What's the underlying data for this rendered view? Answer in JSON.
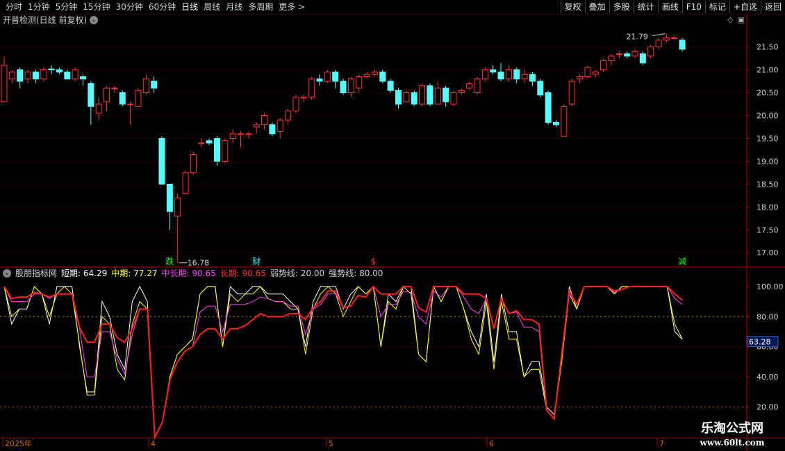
{
  "toolbar": {
    "periods": [
      "分时",
      "1分钟",
      "5分钟",
      "15分钟",
      "30分钟",
      "60分钟",
      "日线",
      "周线",
      "月线",
      "多周期",
      "更多 >"
    ],
    "active_period": "日线",
    "right_buttons": [
      "复权",
      "叠加",
      "多股",
      "统计",
      "画线",
      "F10",
      "标记",
      "+自选",
      "返回"
    ]
  },
  "main_panel": {
    "title": "开普检测(日线 前复权)",
    "icons": [
      "diamond-icon",
      "window-icon"
    ],
    "high_label": "21.79",
    "low_label": "16.78",
    "event_markers": [
      {
        "text": "跌",
        "color": "#00ff00"
      },
      {
        "text": "财",
        "color": "#00ffff"
      },
      {
        "text": "$",
        "color": "#ff3030"
      },
      {
        "text": "减",
        "color": "#00ff00"
      }
    ]
  },
  "indicator": {
    "name": "股朋指标网",
    "short_label": "短期:",
    "short_value": "64.29",
    "mid_label": "中期:",
    "mid_value": "77.27",
    "midlong_label": "中长期:",
    "midlong_value": "90.65",
    "long_label": "长期:",
    "long_value": "90.65",
    "weak_label": "弱势线:",
    "weak_value": "20.00",
    "strong_label": "强势线:",
    "strong_value": "80.00",
    "current_value": "63.28"
  },
  "x_axis": {
    "labels": [
      "2025年",
      "4",
      "5",
      "6",
      "7"
    ]
  },
  "watermark": {
    "line1": "乐淘公式网",
    "line2": "www.60lt.com"
  },
  "colors": {
    "up": "#ff3232",
    "down": "#54ffff",
    "short": "#ffffff",
    "mid": "#ffff00",
    "midlong": "#ff40ff",
    "long": "#ff2020",
    "grid": "#6b0000",
    "axis": "#b00000"
  },
  "chart_data": [
    {
      "type": "candlestick",
      "title": "开普检测(日线 前复权)",
      "y_ticks": [
        17.0,
        17.5,
        18.0,
        18.5,
        19.0,
        19.5,
        20.0,
        20.5,
        21.0,
        21.5
      ],
      "ylim": [
        16.7,
        21.95
      ],
      "candles": [
        {
          "o": 20.3,
          "c": 21.1,
          "h": 21.3,
          "l": 20.3
        },
        {
          "o": 20.8,
          "c": 20.95,
          "h": 21.0,
          "l": 20.7
        },
        {
          "o": 21.0,
          "c": 20.75,
          "h": 21.05,
          "l": 20.6
        },
        {
          "o": 20.8,
          "c": 20.95,
          "h": 21.0,
          "l": 20.7
        },
        {
          "o": 20.95,
          "c": 20.8,
          "h": 21.0,
          "l": 20.7
        },
        {
          "o": 20.8,
          "c": 21.0,
          "h": 21.05,
          "l": 20.75
        },
        {
          "o": 21.02,
          "c": 21.0,
          "h": 21.1,
          "l": 20.9
        },
        {
          "o": 21.0,
          "c": 20.95,
          "h": 21.05,
          "l": 20.9
        },
        {
          "o": 20.95,
          "c": 20.8,
          "h": 21.0,
          "l": 20.8
        },
        {
          "o": 20.8,
          "c": 21.0,
          "h": 21.05,
          "l": 20.75
        },
        {
          "o": 20.85,
          "c": 20.8,
          "h": 20.9,
          "l": 20.65
        },
        {
          "o": 20.7,
          "c": 20.2,
          "h": 20.75,
          "l": 19.8
        },
        {
          "o": 20.05,
          "c": 20.25,
          "h": 20.4,
          "l": 19.9
        },
        {
          "o": 20.3,
          "c": 20.6,
          "h": 20.65,
          "l": 20.1
        },
        {
          "o": 20.6,
          "c": 20.6,
          "h": 20.65,
          "l": 20.5
        },
        {
          "o": 20.5,
          "c": 20.25,
          "h": 20.55,
          "l": 20.2
        },
        {
          "o": 20.25,
          "c": 20.25,
          "h": 20.3,
          "l": 19.8
        },
        {
          "o": 20.2,
          "c": 20.55,
          "h": 20.6,
          "l": 20.2
        },
        {
          "o": 20.5,
          "c": 20.8,
          "h": 20.9,
          "l": 20.45
        },
        {
          "o": 20.75,
          "c": 20.6,
          "h": 20.85,
          "l": 20.5
        },
        {
          "o": 19.5,
          "c": 18.5,
          "h": 19.55,
          "l": 18.5
        },
        {
          "o": 18.5,
          "c": 17.9,
          "h": 18.5,
          "l": 17.5
        },
        {
          "o": 17.8,
          "c": 18.2,
          "h": 18.3,
          "l": 16.78
        },
        {
          "o": 18.3,
          "c": 18.75,
          "h": 18.8,
          "l": 18.3
        },
        {
          "o": 18.75,
          "c": 19.15,
          "h": 19.2,
          "l": 18.7
        },
        {
          "o": 19.4,
          "c": 19.4,
          "h": 19.5,
          "l": 19.3
        },
        {
          "o": 19.45,
          "c": 19.4,
          "h": 19.5,
          "l": 19.35
        },
        {
          "o": 19.5,
          "c": 19.0,
          "h": 19.55,
          "l": 18.9
        },
        {
          "o": 19.0,
          "c": 19.45,
          "h": 19.5,
          "l": 18.95
        },
        {
          "o": 19.5,
          "c": 19.6,
          "h": 19.7,
          "l": 19.4
        },
        {
          "o": 19.6,
          "c": 19.6,
          "h": 19.65,
          "l": 19.3
        },
        {
          "o": 19.6,
          "c": 19.6,
          "h": 19.65,
          "l": 19.5
        },
        {
          "o": 19.75,
          "c": 19.8,
          "h": 19.85,
          "l": 19.6
        },
        {
          "o": 19.8,
          "c": 20.0,
          "h": 20.05,
          "l": 19.7
        },
        {
          "o": 19.8,
          "c": 19.6,
          "h": 19.85,
          "l": 19.55
        },
        {
          "o": 19.65,
          "c": 19.9,
          "h": 19.95,
          "l": 19.5
        },
        {
          "o": 19.9,
          "c": 20.1,
          "h": 20.15,
          "l": 19.8
        },
        {
          "o": 20.1,
          "c": 20.4,
          "h": 20.45,
          "l": 20.05
        },
        {
          "o": 20.4,
          "c": 20.4,
          "h": 20.45,
          "l": 20.3
        },
        {
          "o": 20.4,
          "c": 20.8,
          "h": 20.85,
          "l": 20.35
        },
        {
          "o": 20.8,
          "c": 20.75,
          "h": 20.9,
          "l": 20.65
        },
        {
          "o": 20.75,
          "c": 20.95,
          "h": 21.0,
          "l": 20.7
        },
        {
          "o": 20.95,
          "c": 20.75,
          "h": 21.0,
          "l": 20.6
        },
        {
          "o": 20.75,
          "c": 20.5,
          "h": 20.8,
          "l": 20.45
        },
        {
          "o": 20.5,
          "c": 20.8,
          "h": 20.85,
          "l": 20.4
        },
        {
          "o": 20.6,
          "c": 20.85,
          "h": 20.9,
          "l": 20.5
        },
        {
          "o": 20.85,
          "c": 20.9,
          "h": 20.95,
          "l": 20.8
        },
        {
          "o": 20.9,
          "c": 20.95,
          "h": 21.0,
          "l": 20.85
        },
        {
          "o": 20.95,
          "c": 20.75,
          "h": 21.0,
          "l": 20.7
        },
        {
          "o": 20.75,
          "c": 20.55,
          "h": 20.8,
          "l": 20.5
        },
        {
          "o": 20.55,
          "c": 20.25,
          "h": 20.6,
          "l": 20.15
        },
        {
          "o": 20.3,
          "c": 20.5,
          "h": 20.55,
          "l": 20.3
        },
        {
          "o": 20.5,
          "c": 20.25,
          "h": 20.55,
          "l": 20.2
        },
        {
          "o": 20.25,
          "c": 20.65,
          "h": 20.7,
          "l": 20.2
        },
        {
          "o": 20.65,
          "c": 20.25,
          "h": 20.7,
          "l": 20.2
        },
        {
          "o": 20.25,
          "c": 20.6,
          "h": 20.75,
          "l": 20.25
        },
        {
          "o": 20.6,
          "c": 20.3,
          "h": 20.65,
          "l": 20.2
        },
        {
          "o": 20.25,
          "c": 20.5,
          "h": 20.55,
          "l": 20.2
        },
        {
          "o": 20.5,
          "c": 20.55,
          "h": 20.6,
          "l": 20.45
        },
        {
          "o": 20.6,
          "c": 20.7,
          "h": 20.75,
          "l": 20.55
        },
        {
          "o": 20.5,
          "c": 20.8,
          "h": 20.85,
          "l": 20.45
        },
        {
          "o": 20.8,
          "c": 21.0,
          "h": 21.05,
          "l": 20.75
        },
        {
          "o": 21.0,
          "c": 20.95,
          "h": 21.1,
          "l": 20.9
        },
        {
          "o": 20.95,
          "c": 20.8,
          "h": 21.15,
          "l": 20.75
        },
        {
          "o": 20.8,
          "c": 21.0,
          "h": 21.1,
          "l": 20.75
        },
        {
          "o": 21.0,
          "c": 20.8,
          "h": 21.05,
          "l": 20.7
        },
        {
          "o": 20.8,
          "c": 20.9,
          "h": 21.0,
          "l": 20.7
        },
        {
          "o": 20.9,
          "c": 20.75,
          "h": 20.95,
          "l": 20.65
        },
        {
          "o": 20.75,
          "c": 20.45,
          "h": 20.8,
          "l": 20.4
        },
        {
          "o": 20.5,
          "c": 19.85,
          "h": 20.55,
          "l": 19.8
        },
        {
          "o": 19.85,
          "c": 19.8,
          "h": 19.9,
          "l": 19.75
        },
        {
          "o": 19.55,
          "c": 20.2,
          "h": 20.25,
          "l": 19.55
        },
        {
          "o": 20.25,
          "c": 20.75,
          "h": 20.8,
          "l": 20.2
        },
        {
          "o": 20.8,
          "c": 20.85,
          "h": 20.9,
          "l": 20.7
        },
        {
          "o": 20.85,
          "c": 21.05,
          "h": 21.1,
          "l": 20.8
        },
        {
          "o": 20.9,
          "c": 20.95,
          "h": 21.0,
          "l": 20.85
        },
        {
          "o": 21.0,
          "c": 21.2,
          "h": 21.25,
          "l": 20.95
        },
        {
          "o": 21.2,
          "c": 21.3,
          "h": 21.35,
          "l": 21.1
        },
        {
          "o": 21.35,
          "c": 21.35,
          "h": 21.4,
          "l": 21.25
        },
        {
          "o": 21.35,
          "c": 21.3,
          "h": 21.4,
          "l": 21.25
        },
        {
          "o": 21.3,
          "c": 21.4,
          "h": 21.45,
          "l": 21.25
        },
        {
          "o": 21.35,
          "c": 21.15,
          "h": 21.4,
          "l": 21.1
        },
        {
          "o": 21.3,
          "c": 21.5,
          "h": 21.55,
          "l": 21.25
        },
        {
          "o": 21.5,
          "c": 21.65,
          "h": 21.7,
          "l": 21.45
        },
        {
          "o": 21.65,
          "c": 21.7,
          "h": 21.79,
          "l": 21.6
        },
        {
          "o": 21.7,
          "c": 21.7,
          "h": 21.75,
          "l": 21.65
        },
        {
          "o": 21.65,
          "c": 21.45,
          "h": 21.7,
          "l": 21.4
        }
      ]
    },
    {
      "type": "line",
      "title": "股朋指标网",
      "y_ticks": [
        20.0,
        40.0,
        60.0,
        80.0,
        100.0
      ],
      "ylim": [
        0,
        105
      ],
      "hlines": [
        20,
        80
      ],
      "series": [
        {
          "name": "短期",
          "color": "#ffffff",
          "values": [
            100,
            75,
            85,
            85,
            100,
            95,
            75,
            100,
            100,
            100,
            60,
            30,
            30,
            90,
            80,
            55,
            45,
            90,
            100,
            90,
            0,
            10,
            40,
            55,
            60,
            65,
            95,
            100,
            100,
            60,
            100,
            95,
            95,
            100,
            100,
            95,
            95,
            95,
            90,
            85,
            60,
            90,
            100,
            100,
            100,
            85,
            95,
            100,
            95,
            100,
            60,
            95,
            90,
            100,
            100,
            55,
            50,
            100,
            90,
            100,
            100,
            85,
            70,
            60,
            95,
            50,
            95,
            70,
            70,
            40,
            50,
            50,
            20,
            15,
            50,
            100,
            85,
            100,
            100,
            100,
            100,
            95,
            100,
            100,
            100,
            100,
            100,
            100,
            100,
            70,
            65
          ]
        },
        {
          "name": "中期",
          "color": "#ffff00",
          "values": [
            100,
            80,
            85,
            85,
            100,
            95,
            80,
            95,
            100,
            95,
            62,
            28,
            28,
            80,
            75,
            45,
            38,
            75,
            90,
            85,
            0,
            10,
            40,
            55,
            60,
            65,
            95,
            100,
            100,
            60,
            95,
            90,
            95,
            95,
            100,
            92,
            90,
            90,
            85,
            85,
            55,
            85,
            95,
            100,
            95,
            80,
            90,
            100,
            95,
            100,
            60,
            90,
            85,
            100,
            95,
            55,
            50,
            100,
            90,
            100,
            100,
            85,
            65,
            55,
            90,
            45,
            90,
            65,
            65,
            40,
            45,
            45,
            18,
            12,
            50,
            95,
            85,
            100,
            100,
            100,
            100,
            95,
            100,
            100,
            100,
            100,
            100,
            100,
            100,
            75,
            65
          ]
        },
        {
          "name": "中长期",
          "color": "#ff40ff",
          "values": [
            100,
            90,
            90,
            90,
            95,
            95,
            92,
            95,
            95,
            95,
            72,
            40,
            40,
            70,
            70,
            52,
            42,
            68,
            85,
            85,
            0,
            10,
            38,
            50,
            57,
            60,
            83,
            87,
            87,
            70,
            88,
            88,
            88,
            90,
            93,
            92,
            90,
            90,
            87,
            87,
            68,
            85,
            88,
            95,
            95,
            86,
            87,
            94,
            93,
            100,
            80,
            88,
            88,
            97,
            96,
            80,
            75,
            97,
            93,
            100,
            100,
            93,
            85,
            82,
            92,
            72,
            92,
            82,
            83,
            73,
            73,
            70,
            18,
            12,
            55,
            95,
            88,
            100,
            100,
            100,
            100,
            96,
            98,
            100,
            100,
            100,
            100,
            100,
            100,
            92,
            88
          ]
        },
        {
          "name": "长期",
          "color": "#ff2020",
          "values": [
            100,
            92,
            93,
            93,
            96,
            95,
            93,
            95,
            95,
            95,
            73,
            63,
            63,
            75,
            75,
            66,
            63,
            72,
            85,
            85,
            0,
            10,
            38,
            50,
            57,
            60,
            68,
            72,
            72,
            65,
            72,
            72,
            74,
            78,
            82,
            80,
            80,
            80,
            82,
            82,
            78,
            86,
            90,
            97,
            97,
            86,
            87,
            94,
            93,
            100,
            95,
            95,
            95,
            100,
            100,
            86,
            83,
            100,
            100,
            100,
            100,
            95,
            95,
            95,
            92,
            72,
            92,
            82,
            84,
            78,
            78,
            75,
            18,
            12,
            55,
            97,
            88,
            100,
            100,
            100,
            100,
            97,
            98,
            100,
            100,
            100,
            100,
            100,
            100,
            95,
            91
          ]
        }
      ]
    }
  ]
}
